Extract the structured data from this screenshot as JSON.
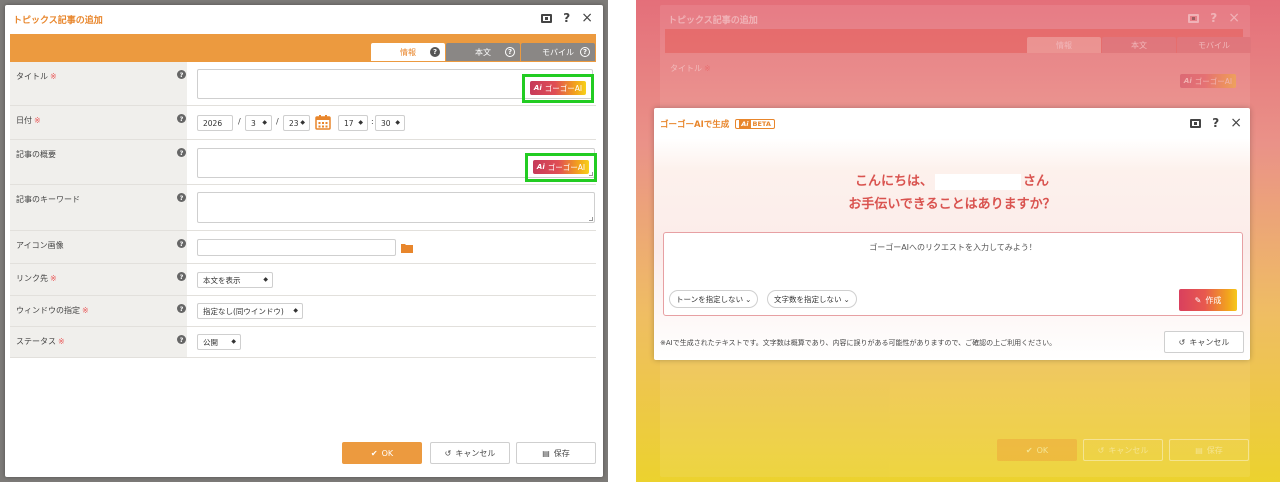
{
  "dialog": {
    "title": "トピックス記事の追加",
    "tabs": [
      {
        "label": "情報",
        "active": true
      },
      {
        "label": "本文",
        "active": false
      },
      {
        "label": "モバイル",
        "active": false
      }
    ],
    "help_glyph": "?",
    "close_glyph": "×",
    "required_mark": "※",
    "fields": {
      "title": {
        "label": "タイトル"
      },
      "date": {
        "label": "日付",
        "year": "2026",
        "month": "3",
        "day": "23",
        "hour": "17",
        "minute": "30",
        "sep_slash": "/",
        "sep_colon": ":"
      },
      "summary": {
        "label": "記事の概要"
      },
      "keywords": {
        "label": "記事のキーワード"
      },
      "icon_image": {
        "label": "アイコン画像"
      },
      "link": {
        "label": "リンク先",
        "value": "本文を表示"
      },
      "window": {
        "label": "ウィンドウの指定",
        "value": "指定なし(同ウインドウ)"
      },
      "status": {
        "label": "ステータス",
        "value": "公開"
      }
    },
    "ai_button_label": "ゴーゴーAI",
    "ai_mark": "Ai",
    "buttons": {
      "ok": "OK",
      "cancel": "キャンセル",
      "save": "保存"
    }
  },
  "ai_modal": {
    "title": "ゴーゴーAIで生成",
    "beta": "BETA",
    "greeting_prefix": "こんにちは、",
    "greeting_suffix": "さん",
    "greeting_line2": "お手伝いできることはありますか？",
    "request_placeholder": "ゴーゴーAIへのリクエストを入力してみよう！",
    "tone_option": "トーンを指定しない",
    "length_option": "文字数を指定しない",
    "create_label": "作成",
    "note": "※AIで生成されたテキストです。文字数は概算であり、内容に誤りがある可能性がありますので、ご確認の上ご利用ください。",
    "cancel_label": "キャンセル"
  },
  "colors": {
    "accent": "#ec9a3f",
    "highlight": "#22cc22",
    "greeting": "#d9534f"
  }
}
